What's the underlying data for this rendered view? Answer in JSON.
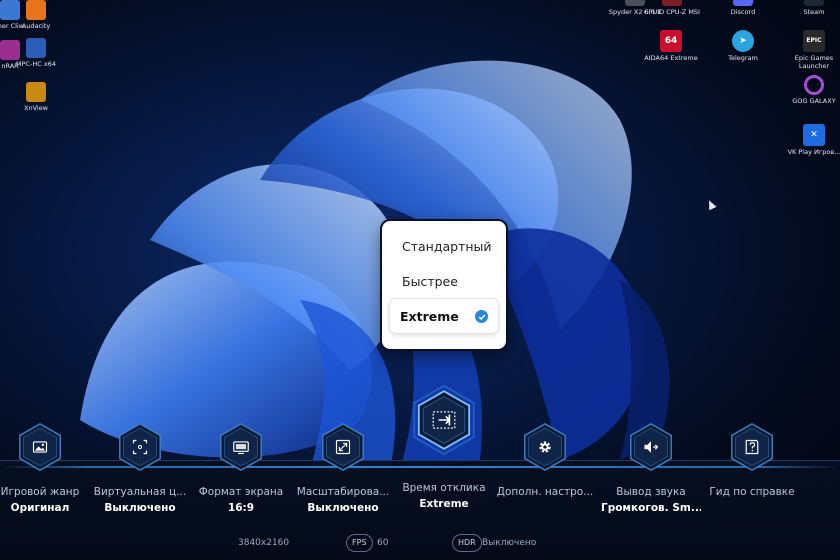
{
  "desktop": {
    "left_icons": [
      {
        "label": "Ether Clie...",
        "color": "#3a78d4"
      },
      {
        "label": "Audacity",
        "color": "#e8741c"
      },
      {
        "label": "nRAR",
        "color": "#9b2d8f"
      },
      {
        "label": "MPC-HC x64",
        "color": "#2b5cb8"
      },
      {
        "label": "XnView",
        "color": "#c98a12"
      }
    ],
    "right_icons": [
      {
        "label": "Spyder X2 6.0.1",
        "color": "#4a4f5a"
      },
      {
        "label": "CPUID CPU-Z MSI",
        "color": "#7a1f24"
      },
      {
        "label": "Discord",
        "color": "#5865f2"
      },
      {
        "label": "Steam",
        "color": "#1b2838"
      },
      {
        "label": "AIDA64 Extreme",
        "color": "#c8102e",
        "glyph": "64"
      },
      {
        "label": "Telegram",
        "color": "#2aa3df"
      },
      {
        "label": "Epic Games Launcher",
        "color": "#2a2a2a",
        "glyph": "EPIC"
      },
      {
        "label": "GOG GALAXY",
        "color": "#8a3ab9"
      },
      {
        "label": "VK Play Игров...",
        "color": "#1e6de0"
      }
    ]
  },
  "dropdown": {
    "options": [
      "Стандартный",
      "Быстрее",
      "Extreme"
    ],
    "selected": "Extreme"
  },
  "settings": [
    {
      "label": "Игровой жанр",
      "value": "Оригинал",
      "icon": "image-icon"
    },
    {
      "label": "Виртуальная ц...",
      "value": "Выключено",
      "icon": "crosshair-icon"
    },
    {
      "label": "Формат экрана",
      "value": "16:9",
      "icon": "screen-icon"
    },
    {
      "label": "Масштабирова...",
      "value": "Выключено",
      "icon": "scale-icon"
    },
    {
      "label": "Время отклика",
      "value": "Extreme",
      "icon": "response-time-icon"
    },
    {
      "label": "Дополн. настро...",
      "value": "",
      "icon": "gear-icon"
    },
    {
      "label": "Вывод звука",
      "value": "Громкогов. Sm...",
      "icon": "speaker-icon"
    },
    {
      "label": "Гид по справке",
      "value": "",
      "icon": "help-icon"
    }
  ],
  "status": {
    "resolution": "3840x2160",
    "fps_label": "FPS",
    "fps_value": "60",
    "hdr_label": "HDR",
    "hdr_value": "Выключено"
  },
  "colors": {
    "accent": "#2b86d8",
    "check": "#2a86d6"
  }
}
